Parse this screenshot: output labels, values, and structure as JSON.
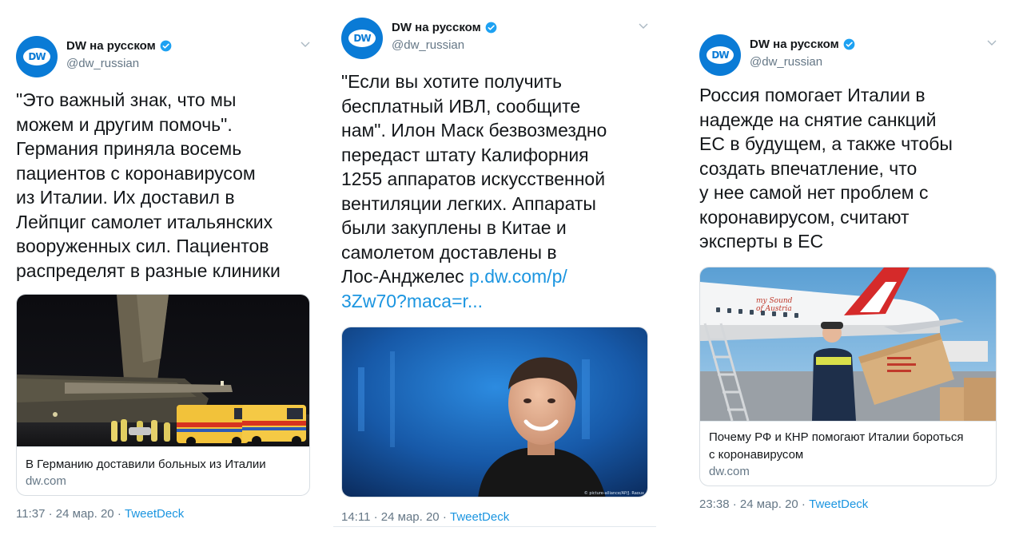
{
  "tweets": [
    {
      "author_name": "DW на русском",
      "author_handle": "@dw_russian",
      "text": "\"Это важный знак, что мы\nможем и другим помочь\".\nГермания приняла восемь\nпациентов с коронавирусом\nиз Италии. Их доставил в\nЛейпциг самолет итальянских\nвооруженных сил. Пациентов\nраспределят в разные клиники",
      "card_title": "В Германию доставили больных из Италии",
      "card_domain": "dw.com",
      "time": "11:37",
      "date": "24 мар. 20",
      "source": "TweetDeck"
    },
    {
      "author_name": "DW на русском",
      "author_handle": "@dw_russian",
      "text": "\"Если вы хотите получить\nбесплатный ИВЛ, сообщите\nнам\". Илон Маск безвозмездно\nпередаст штату Калифорния\n1255 аппаратов искусственной\nвентиляции легких. Аппараты\nбыли закуплены в Китае и\nсамолетом доставлены в\nЛос-Анджелес ",
      "link": "p.dw.com/p/\n3Zw70?maca=r...",
      "image_credit": "© picture-alliance/AP/J. Raoux",
      "time": "14:11",
      "date": "24 мар. 20",
      "source": "TweetDeck"
    },
    {
      "author_name": "DW на русском",
      "author_handle": "@dw_russian",
      "text": "Россия помогает Италии в\nнадежде на снятие санкций\nЕС в будущем, а также чтобы\nсоздать впечатление, что\nу нее самой нет проблем с\nкоронавирусом, считают\nэксперты в ЕС",
      "image_text": "my Sound\nof Austria",
      "card_title": "Почему РФ и КНР помогают Италии бороться\nс коронавирусом",
      "card_domain": "dw.com",
      "time": "23:38",
      "date": "24 мар. 20",
      "source": "TweetDeck"
    }
  ],
  "brand": {
    "logo_text": "DW",
    "accent": "#1b95e0",
    "avatar_bg": "#0a7bd6"
  },
  "separator": " · "
}
